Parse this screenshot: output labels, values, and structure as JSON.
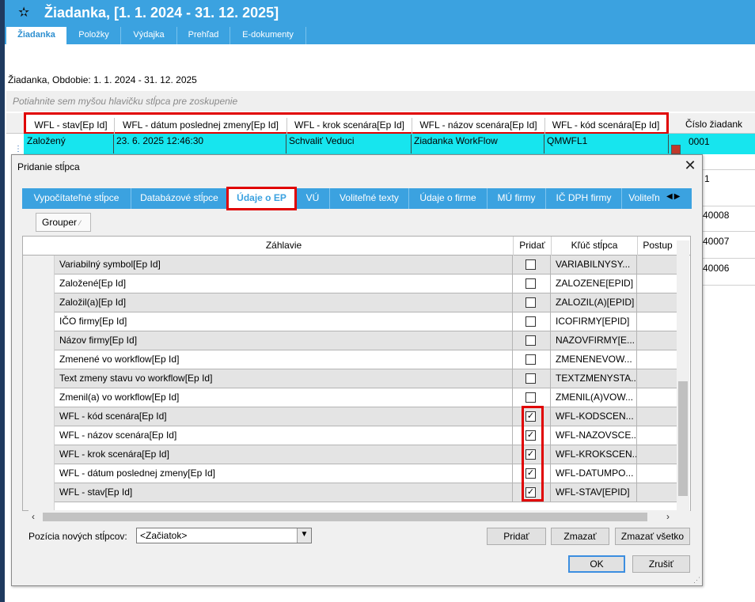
{
  "window": {
    "title": "Žiadanka,  [1. 1. 2024 - 31. 12. 2025]"
  },
  "nav_tabs": [
    "Žiadanka",
    "Položky",
    "Výdajka",
    "Prehľad",
    "E-dokumenty"
  ],
  "info": {
    "period_text": "Žiadanka, Obdobie: 1. 1. 2024 - 31. 12. 2025",
    "group_hint": "Potiahnite sem myšou hlavičku stĺpca pre zoskupenie"
  },
  "bg_grid": {
    "columns": [
      "WFL - stav[Ep Id]",
      "WFL - dátum poslednej zmeny[Ep Id]",
      "WFL - krok scenára[Ep Id]",
      "WFL - názov scenára[Ep Id]",
      "WFL - kód scenára[Ep Id]"
    ],
    "extra_column": "Číslo žiadank",
    "row1": [
      "Založený",
      "23. 6. 2025 12:46:30",
      "Schvaliť Veduci",
      "Ziadanka WorkFlow",
      "QMWFL1"
    ],
    "row1_number": "0001",
    "other_numbers": [
      "1",
      "40008",
      "40007",
      "40006"
    ]
  },
  "dialog": {
    "title": "Pridanie stĺpca",
    "close_glyph": "✕",
    "tabs": [
      "Vypočítateľné stĺpce",
      "Databázové stĺpce",
      "Údaje o EP",
      "VÚ",
      "Voliteľné texty",
      "Údaje o firme",
      "MÚ firmy",
      "IČ DPH firmy",
      "Voliteľn"
    ],
    "active_tab": "Údaje o EP",
    "grouper_label": "Grouper",
    "grid": {
      "headers": [
        "Záhlavie",
        "Pridať",
        "Kľúč stĺpca",
        "Postup"
      ],
      "rows": [
        {
          "header": "Variabilný symbol[Ep Id]",
          "checked": false,
          "key": "VARIABILNYSY..."
        },
        {
          "header": "Založené[Ep Id]",
          "checked": false,
          "key": "ZALOZENE[EPID]"
        },
        {
          "header": "Založil(a)[Ep Id]",
          "checked": false,
          "key": "ZALOZIL(A)[EPID]"
        },
        {
          "header": "IČO firmy[Ep Id]",
          "checked": false,
          "key": "ICOFIRMY[EPID]"
        },
        {
          "header": "Názov firmy[Ep Id]",
          "checked": false,
          "key": "NAZOVFIRMY[E..."
        },
        {
          "header": "Zmenené vo workflow[Ep Id]",
          "checked": false,
          "key": "ZMENENEVOW..."
        },
        {
          "header": "Text zmeny stavu vo workflow[Ep Id]",
          "checked": false,
          "key": "TEXTZMENYSTA..."
        },
        {
          "header": "Zmenil(a) vo workflow[Ep Id]",
          "checked": false,
          "key": "ZMENIL(A)VOW..."
        },
        {
          "header": "WFL - kód scenára[Ep Id]",
          "checked": true,
          "key": "WFL-KODSCEN..."
        },
        {
          "header": "WFL - názov scenára[Ep Id]",
          "checked": true,
          "key": "WFL-NAZOVSCE..."
        },
        {
          "header": "WFL - krok scenára[Ep Id]",
          "checked": true,
          "key": "WFL-KROKSCEN..."
        },
        {
          "header": "WFL - dátum poslednej zmeny[Ep Id]",
          "checked": true,
          "key": "WFL-DATUMPO..."
        },
        {
          "header": "WFL - stav[Ep Id]",
          "checked": true,
          "key": "WFL-STAV[EPID]"
        }
      ]
    },
    "position_label": "Pozícia nových stĺpcov:",
    "position_value": "<Začiatok>",
    "buttons": {
      "add": "Pridať",
      "delete": "Zmazať",
      "delete_all": "Zmazať všetko",
      "ok": "OK",
      "cancel": "Zrušiť"
    }
  },
  "colors": {
    "accent_blue": "#3ba2e0",
    "row_cyan": "#17e5ee",
    "highlight_red": "#e00000"
  }
}
